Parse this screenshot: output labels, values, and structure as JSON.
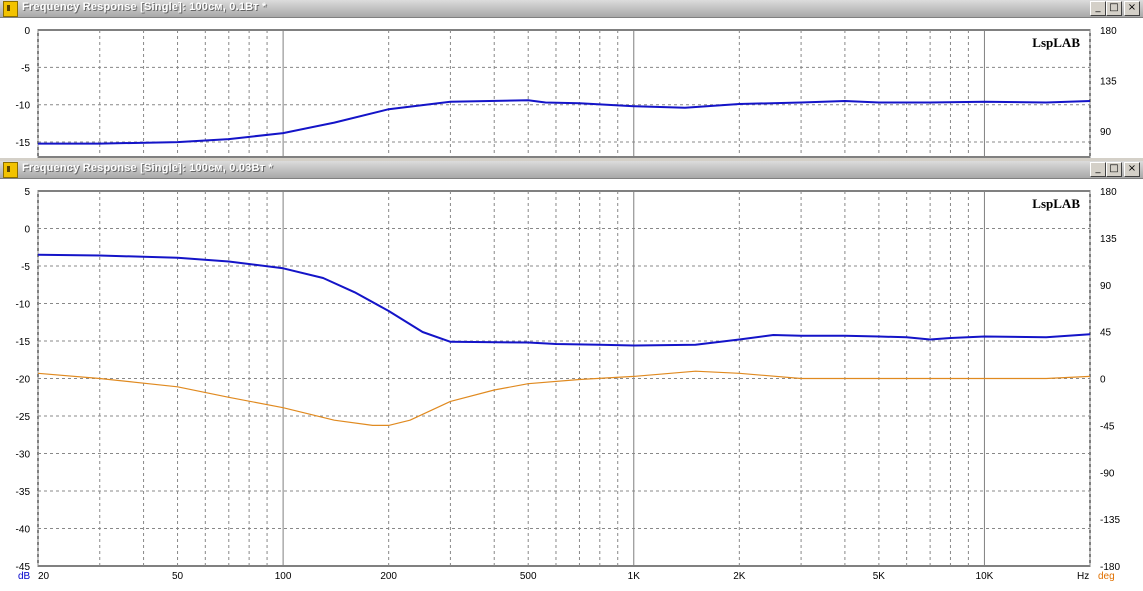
{
  "windows": [
    {
      "title": "Frequency Response [Single]: 100см, 0.1Вт *",
      "controls": {
        "minimize": "_",
        "maximize": "□",
        "close": "×"
      },
      "brand": "LspLAB"
    },
    {
      "title": "Frequency Response [Single]: 100см, 0.03Вт *",
      "controls": {
        "minimize": "_",
        "maximize": "□",
        "close": "×"
      },
      "brand": "LspLAB"
    }
  ],
  "colors": {
    "magnitude": "#1414c8",
    "phase": "#e08a20",
    "unit_db": "#0000cc",
    "unit_deg": "#e07000"
  },
  "chart_data": [
    {
      "type": "line",
      "window": "top",
      "x_scale": "log",
      "xlim": [
        20,
        20000
      ],
      "ylim_left": [
        -17,
        0
      ],
      "ylim_right": [
        67,
        180
      ],
      "y_ticks_left": [
        "0",
        "-5",
        "-10",
        "-15"
      ],
      "y_ticks_right": [
        "180",
        "135",
        "90"
      ],
      "grid": true,
      "series": [
        {
          "axis": "left",
          "x": [
            20,
            30,
            50,
            70,
            100,
            140,
            200,
            300,
            500,
            560,
            700,
            1000,
            1400,
            2000,
            3000,
            4000,
            5000,
            7000,
            10000,
            15000,
            20000
          ],
          "y": [
            -15.2,
            -15.2,
            -15.0,
            -14.6,
            -13.8,
            -12.4,
            -10.6,
            -9.6,
            -9.4,
            -9.7,
            -9.8,
            -10.2,
            -10.4,
            -9.9,
            -9.7,
            -9.5,
            -9.7,
            -9.7,
            -9.6,
            -9.7,
            -9.5
          ]
        }
      ]
    },
    {
      "type": "line",
      "window": "bottom",
      "x_scale": "log",
      "xlim": [
        20,
        20000
      ],
      "x_ticks": [
        "20",
        "50",
        "100",
        "200",
        "500",
        "1K",
        "2K",
        "5K",
        "10K"
      ],
      "x_unit": "Hz",
      "ylim_left": [
        -45,
        5
      ],
      "ylim_right": [
        -180,
        180
      ],
      "y_ticks_left": [
        "5",
        "0",
        "-5",
        "-10",
        "-15",
        "-20",
        "-25",
        "-30",
        "-35",
        "-40",
        "-45"
      ],
      "y_ticks_right": [
        "180",
        "135",
        "90",
        "45",
        "0",
        "-45",
        "-90",
        "-135",
        "-180"
      ],
      "y_unit_left": "dB",
      "y_unit_right": "deg",
      "grid": true,
      "series": [
        {
          "axis": "left",
          "x": [
            20,
            30,
            50,
            70,
            100,
            130,
            160,
            200,
            250,
            300,
            500,
            600,
            800,
            1000,
            1500,
            2000,
            2500,
            3000,
            4000,
            5000,
            6000,
            7000,
            8000,
            10000,
            15000,
            20000
          ],
          "y": [
            -3.5,
            -3.6,
            -3.9,
            -4.4,
            -5.3,
            -6.6,
            -8.5,
            -11.0,
            -13.8,
            -15.1,
            -15.2,
            -15.4,
            -15.5,
            -15.6,
            -15.5,
            -14.8,
            -14.2,
            -14.3,
            -14.3,
            -14.4,
            -14.5,
            -14.8,
            -14.6,
            -14.4,
            -14.5,
            -14.1
          ]
        },
        {
          "axis": "right",
          "x": [
            20,
            30,
            50,
            70,
            100,
            140,
            180,
            200,
            230,
            300,
            400,
            500,
            700,
            1000,
            1500,
            2000,
            3000,
            5000,
            7000,
            10000,
            15000,
            20000
          ],
          "y": [
            5,
            0,
            -8,
            -18,
            -28,
            -40,
            -45,
            -45,
            -40,
            -22,
            -11,
            -5,
            -1,
            2,
            7,
            5,
            0,
            0,
            0,
            0,
            0,
            2
          ]
        }
      ]
    }
  ]
}
